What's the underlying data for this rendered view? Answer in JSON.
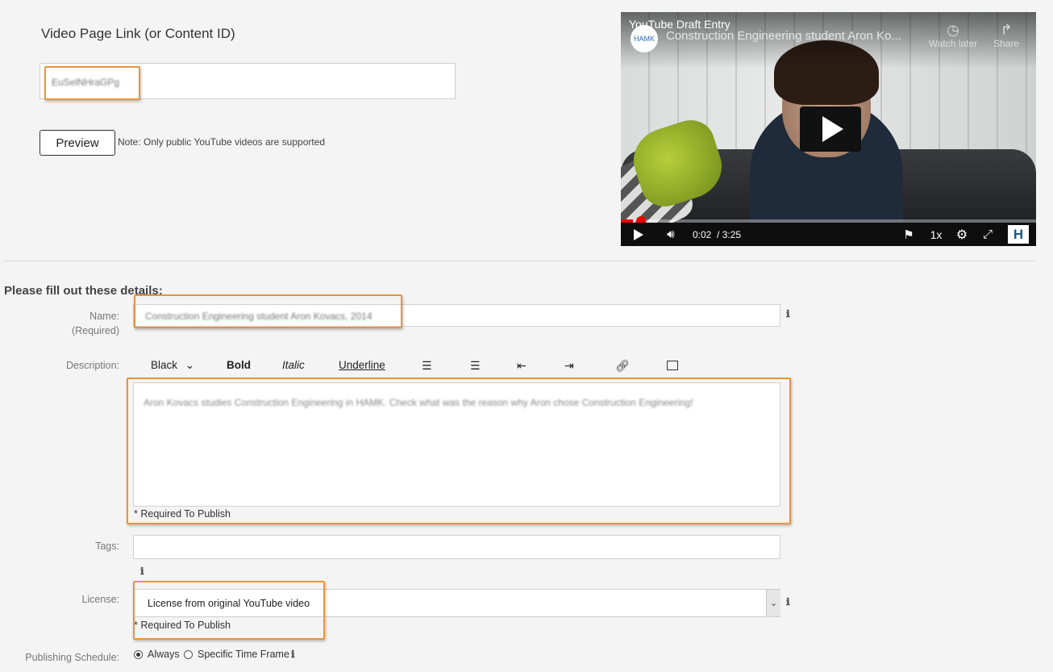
{
  "video_link": {
    "label": "Video Page Link (or Content ID)",
    "value": "EuSelNHraGPg"
  },
  "preview": {
    "button_label": "Preview",
    "note": "Note: Only public YouTube videos are supported"
  },
  "video_player": {
    "overlay_title": "YouTube Draft Entry",
    "channel_badge": "HAMK",
    "video_title": "Construction Engineering student Aron Ko...",
    "watch_later": "Watch later",
    "share": "Share",
    "current_time": "0:02",
    "duration": "/ 3:25",
    "speed": "1x",
    "logo": "H",
    "progress": 0.03
  },
  "form": {
    "heading": "Please fill out these details:",
    "name": {
      "label": "Name:",
      "sublabel": "(Required)",
      "value": "Construction Engineering student Aron Kovacs, 2014"
    },
    "description": {
      "label": "Description:",
      "toolbar": {
        "color": "Black",
        "bold": "Bold",
        "italic": "Italic",
        "underline": "Underline"
      },
      "value": "Aron Kovacs studies Construction Engineering in HAMK. Check what was the reason why Aron chose Construction Engineering!",
      "required_note": "* Required To Publish"
    },
    "tags": {
      "label": "Tags:",
      "value": ""
    },
    "license": {
      "label": "License:",
      "value": "License from original YouTube video",
      "required_note": "* Required To Publish"
    },
    "schedule": {
      "label": "Publishing Schedule:",
      "option_always": "Always",
      "option_specific": "Specific Time Frame"
    }
  },
  "icons": {
    "info": "ℹ",
    "chevron": "⌄"
  },
  "colors": {
    "highlight": "#e8943a",
    "progress": "#ee0000"
  }
}
